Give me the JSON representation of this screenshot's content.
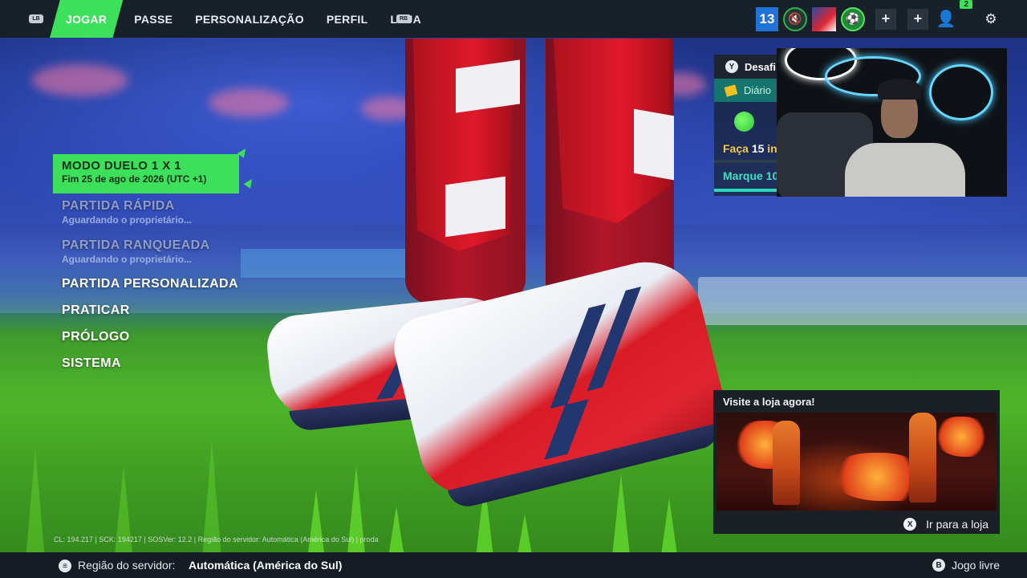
{
  "topbar": {
    "lb": "LB",
    "rb": "RB",
    "tabs": [
      {
        "label": "JOGAR",
        "active": true
      },
      {
        "label": "PASSE",
        "active": false
      },
      {
        "label": "PERSONALIZAÇÃO",
        "active": false
      },
      {
        "label": "PERFIL",
        "active": false
      },
      {
        "label": "LOJA",
        "active": false
      }
    ],
    "level": "13",
    "friends_online": "2",
    "accent": "#3ce05a"
  },
  "menu": {
    "featured": {
      "title": "MODO DUELO 1 X 1",
      "subtitle": "Fim 25 de ago de 2026 (UTC +1)"
    },
    "items": [
      {
        "title": "PARTIDA RÁPIDA",
        "subtitle": "Aguardando o proprietário...",
        "enabled": false
      },
      {
        "title": "PARTIDA RANQUEADA",
        "subtitle": "Aguardando o proprietário...",
        "enabled": false
      },
      {
        "title": "PARTIDA PERSONALIZADA",
        "enabled": true
      },
      {
        "title": "PRATICAR",
        "enabled": true
      },
      {
        "title": "PRÓLOGO",
        "enabled": true
      },
      {
        "title": "SISTEMA",
        "enabled": true
      }
    ]
  },
  "challenges": {
    "button": "Y",
    "title": "Desafi",
    "tab": "Diário",
    "task1_prefix": "Faça ",
    "task1_count": "15",
    "task1_suffix": " in",
    "task2": "Marque 10"
  },
  "shop": {
    "title": "Visite a loja agora!",
    "button": "X",
    "action": "Ir para a loja"
  },
  "footer": {
    "version": "CL: 194.217 | SCK: 194217 | SOSVer: 12.2 | Região do servidor: Automática (América do Sul) | proda",
    "server_label": "Região do servidor:",
    "server_value": "Automática (América do Sul)",
    "free_button": "B",
    "free_label": "Jogo livre"
  }
}
